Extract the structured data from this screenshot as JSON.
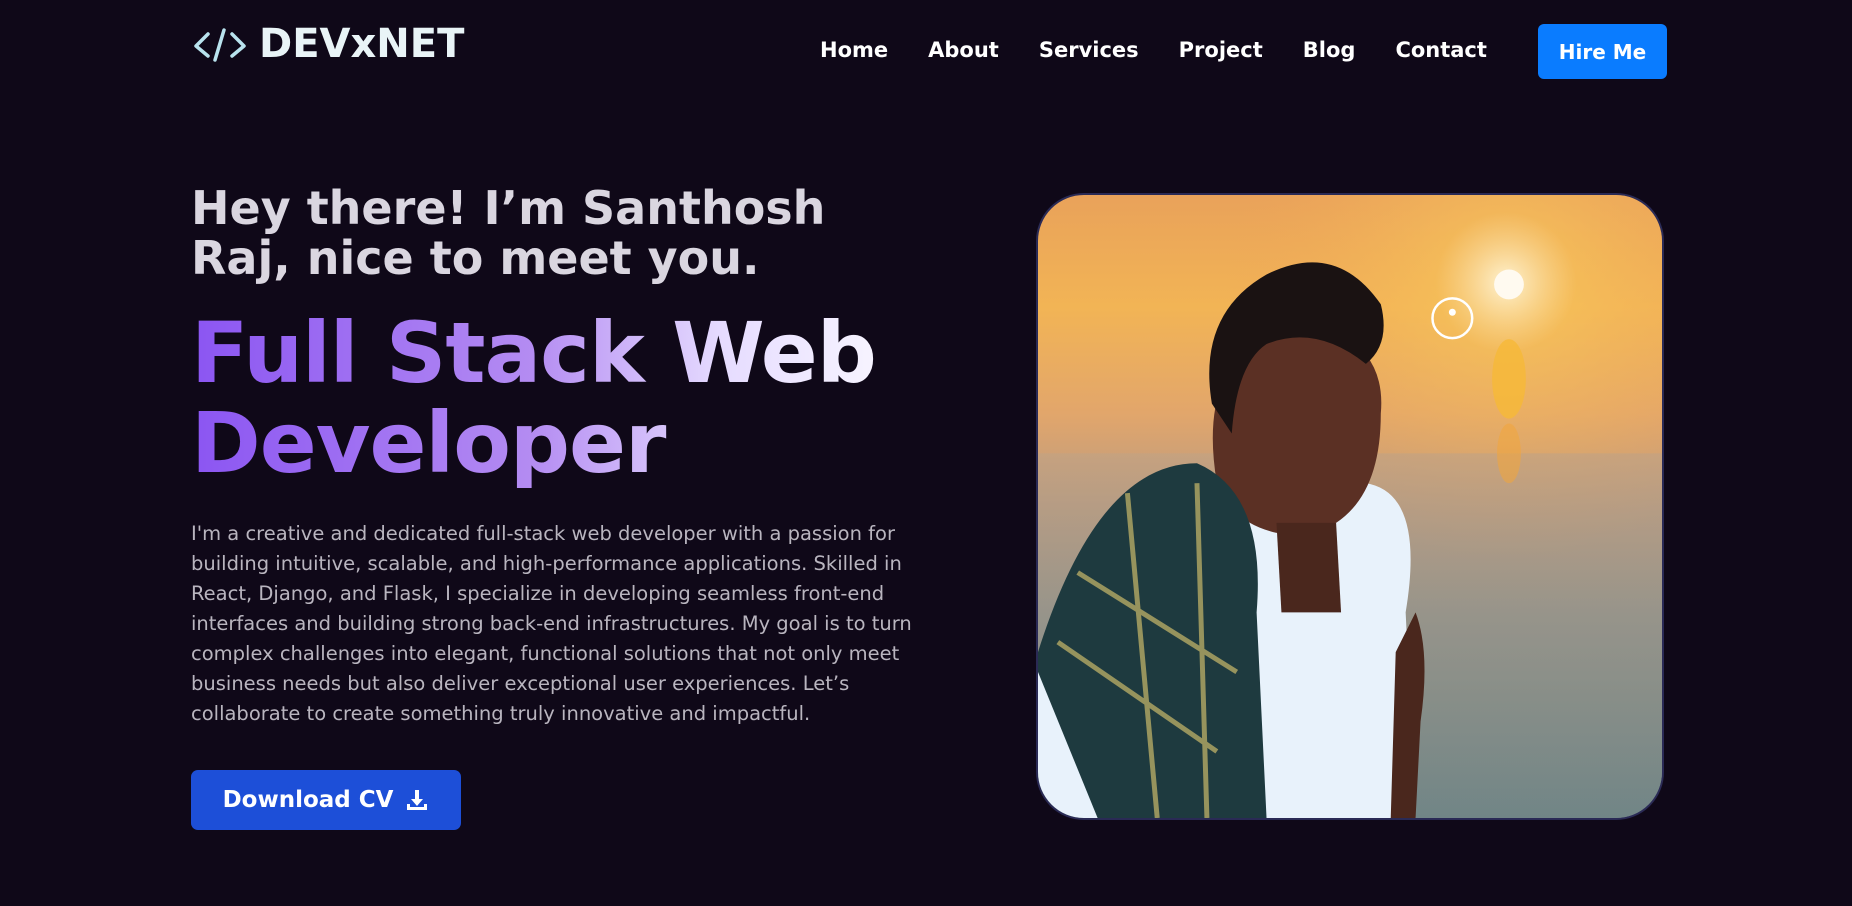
{
  "header": {
    "logo_text": "DEVxNET",
    "nav": [
      "Home",
      "About",
      "Services",
      "Project",
      "Blog",
      "Contact"
    ],
    "cta_label": "Hire Me"
  },
  "hero": {
    "greeting": "Hey there! I’m Santhosh Raj, nice to meet you.",
    "role_line1": "Full Stack Web",
    "role_line2": "Developer",
    "bio": "I'm a creative and dedicated full-stack web developer with a passion for building intuitive, scalable, and high-performance applications. Skilled in React, Django, and Flask, I specialize in developing seamless front-end interfaces and building strong back-end infrastructures. My goal is to turn complex challenges into elegant, functional solutions that not only meet business needs but also deliver exceptional user experiences. Let’s collaborate to create something truly innovative and impactful.",
    "download_label": "Download CV"
  },
  "icons": {
    "logo": "code-brackets-icon",
    "download": "download-icon"
  },
  "colors": {
    "background": "#0f0818",
    "primary_button": "#0a7cff",
    "download_button": "#1d4fd8",
    "gradient_start": "#8b55f2",
    "gradient_end": "#ffffff"
  }
}
